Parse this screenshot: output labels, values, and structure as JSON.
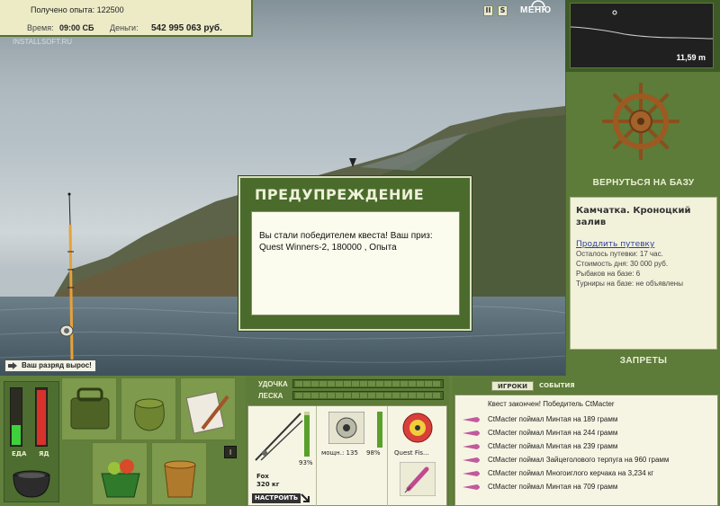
{
  "header": {
    "experience": "Получено опыта: 122500",
    "time_label": "Время:",
    "time_value": "09:00 СБ",
    "money_label": "Деньги:",
    "money_value": "542 995 063 руб."
  },
  "scene": {
    "watermark": "INSTALLSOFT.RU"
  },
  "toolbar": {
    "pause_label": "II",
    "sound_label": "S",
    "menu_label": "МЕНЮ"
  },
  "depth": {
    "value": "11,59 m"
  },
  "base": {
    "back_label": "ВЕРНУТЬСЯ НА БАЗУ",
    "location": "Камчатка. Кроноцкий залив",
    "extend_link": "Продлить путевку",
    "remaining": "Осталось путевки: 17 час.",
    "day_cost": "Стоимость дня: 30 000 руб.",
    "fishers": "Рыбаков на базе: 6",
    "tournaments": "Турниры на базе: не объявлены",
    "bans_label": "ЗАПРЕТЫ"
  },
  "rank": {
    "text": "Ваш разряд вырос!"
  },
  "modal": {
    "title": "ПРЕДУПРЕЖДЕНИЕ",
    "message": "Вы стали победителем квеста! Ваш приз: Quest Winners-2, 180000 , Опыта"
  },
  "meters": {
    "food_label": "ЕДА",
    "food_level": 0.35,
    "food_color": "#3fd13c",
    "drink_label": "ЯД",
    "drink_level": 0.95,
    "drink_color": "#d8322a"
  },
  "slot_button": "I",
  "tackle": {
    "rod_label": "УДОЧКА",
    "line_label": "ЛЕСКА",
    "rod_percent": "93%",
    "rod_name": "Fox",
    "rod_weight": "320 кг",
    "setup_label": "НАСТРОИТЬ",
    "reel_power": "мощн.: 135",
    "reel_percent": "98%",
    "line_name": "Quest Fis..."
  },
  "chat": {
    "tab_players": "ИГРОКИ",
    "tab_events": "СОБЫТИЯ",
    "header": "Квест закончен! Победитель CtMacter",
    "messages": [
      "CtMacter поймал Минтая на 189 грамм",
      "CtMacter поймал Минтая на 244 грамм",
      "CtMacter поймал Минтая на 239 грамм",
      "CtMacter поймал Зайцеголового терпуга на 960 грамм",
      "CtMacter поймал Многоиглого керчака на 3,234 кг",
      "CtMacter поймал Минтая на 709 грамм"
    ]
  }
}
